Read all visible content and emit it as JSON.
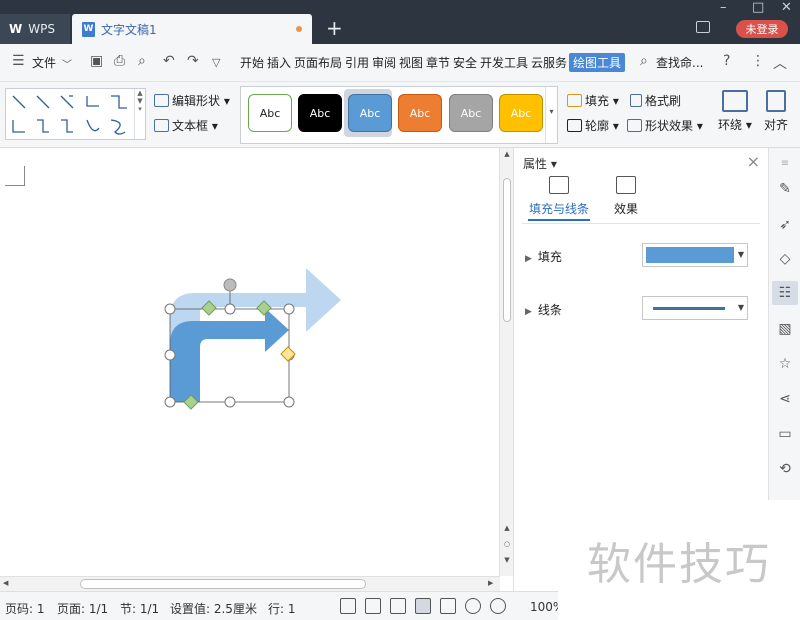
{
  "titlebar": {
    "app_tab": "WPS",
    "doc_tab": "文字文稿1",
    "doc_icon": "W",
    "new_tab": "+",
    "login": "未登录"
  },
  "menu": {
    "file": "文件",
    "items": [
      "开始",
      "插入",
      "页面布局",
      "引用",
      "审阅",
      "视图",
      "章节",
      "安全",
      "开发工具",
      "云服务",
      "绘图工具"
    ],
    "active": "绘图工具",
    "search": "查找命..."
  },
  "ribbon": {
    "edit_shape": "编辑形状",
    "text_box": "文本框",
    "styles": [
      {
        "label": "Abc",
        "bg": "#ffffff",
        "fg": "#222222",
        "border": "#6aa84f"
      },
      {
        "label": "Abc",
        "bg": "#000000",
        "fg": "#ffffff",
        "border": "#000000"
      },
      {
        "label": "Abc",
        "bg": "#5b9bd5",
        "fg": "#ffffff",
        "border": "#41719c"
      },
      {
        "label": "Abc",
        "bg": "#ed7d31",
        "fg": "#ffffff",
        "border": "#c55a11"
      },
      {
        "label": "Abc",
        "bg": "#a5a5a5",
        "fg": "#ffffff",
        "border": "#7f7f7f"
      },
      {
        "label": "Abc",
        "bg": "#ffc000",
        "fg": "#ffffff",
        "border": "#bf9000"
      }
    ],
    "fill": "填充",
    "format_painter": "格式刷",
    "outline": "轮廓",
    "shape_effects": "形状效果",
    "wrap": "环绕",
    "align": "对齐"
  },
  "properties": {
    "title": "属性",
    "tab_fill_line": "填充与线条",
    "tab_effects": "效果",
    "fill_label": "填充",
    "line_label": "线条",
    "fill_color": "#5b9bd5",
    "line_color": "#41719c"
  },
  "statusbar": {
    "page_num": "页码: 1",
    "pages": "页面: 1/1",
    "section": "节: 1/1",
    "setting": "设置值: 2.5厘米",
    "line": "行: 1",
    "zoom": "100%"
  },
  "watermark": "软件技巧",
  "icons": {
    "right_tools": [
      "pen-icon",
      "cursor-icon",
      "shapes-icon",
      "settings-sliders-icon",
      "image-icon",
      "star-icon",
      "share-icon",
      "archive-icon",
      "history-icon"
    ]
  }
}
